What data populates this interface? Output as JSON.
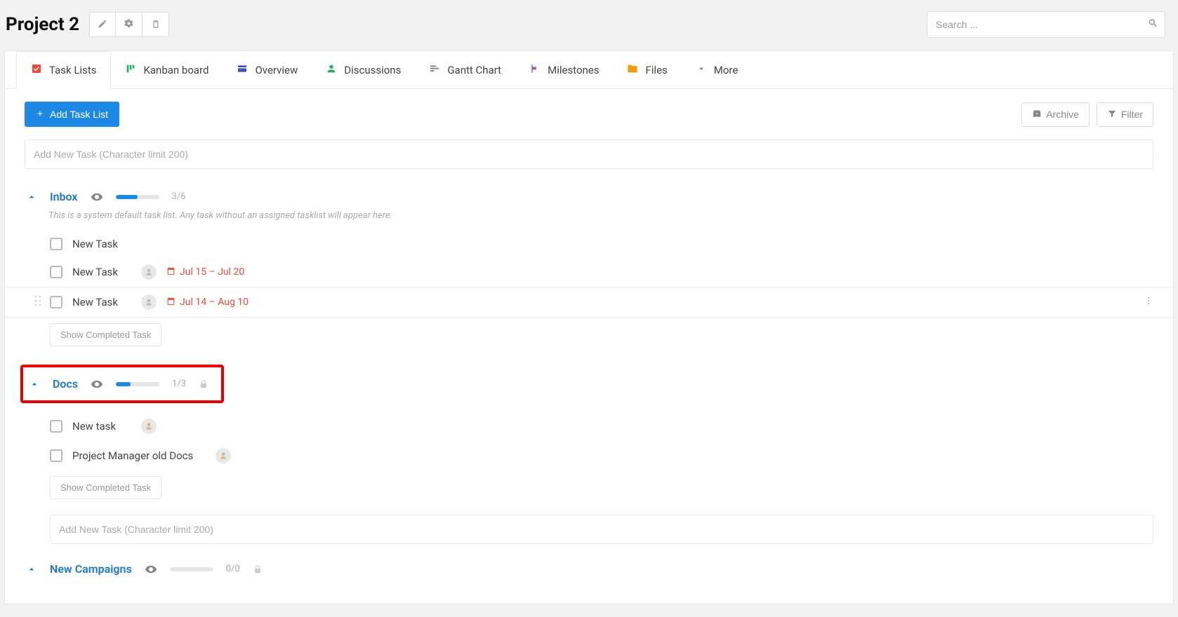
{
  "header": {
    "title": "Project 2",
    "search_placeholder": "Search ..."
  },
  "tabs": [
    {
      "label": "Task Lists"
    },
    {
      "label": "Kanban board"
    },
    {
      "label": "Overview"
    },
    {
      "label": "Discussions"
    },
    {
      "label": "Gantt Chart"
    },
    {
      "label": "Milestones"
    },
    {
      "label": "Files"
    },
    {
      "label": "More"
    }
  ],
  "toolbar": {
    "add_task_list": "Add Task List",
    "archive": "Archive",
    "filter": "Filter"
  },
  "inputs": {
    "add_new_task_placeholder": "Add New Task (Character limit 200)"
  },
  "lists": {
    "inbox": {
      "title": "Inbox",
      "progress_label": "3/6",
      "progress_pct": 50,
      "desc": "This is a system default task list. Any task without an assigned tasklist will appear here.",
      "tasks": [
        {
          "name": "New Task"
        },
        {
          "name": "New Task",
          "date": "Jul 15 – Jul 20",
          "avatar": true
        },
        {
          "name": "New Task",
          "date": "Jul 14 – Aug 10",
          "avatar": true,
          "hovered": true
        }
      ],
      "show_completed": "Show Completed Task"
    },
    "docs": {
      "title": "Docs",
      "progress_label": "1/3",
      "progress_pct": 33,
      "tasks": [
        {
          "name": "New task",
          "tan_avatar": true
        },
        {
          "name": "Project Manager old Docs",
          "tan_avatar": true
        }
      ],
      "show_completed": "Show Completed Task"
    },
    "new_campaigns": {
      "title": "New Campaigns",
      "progress_label": "0/0",
      "progress_pct": 0
    }
  }
}
